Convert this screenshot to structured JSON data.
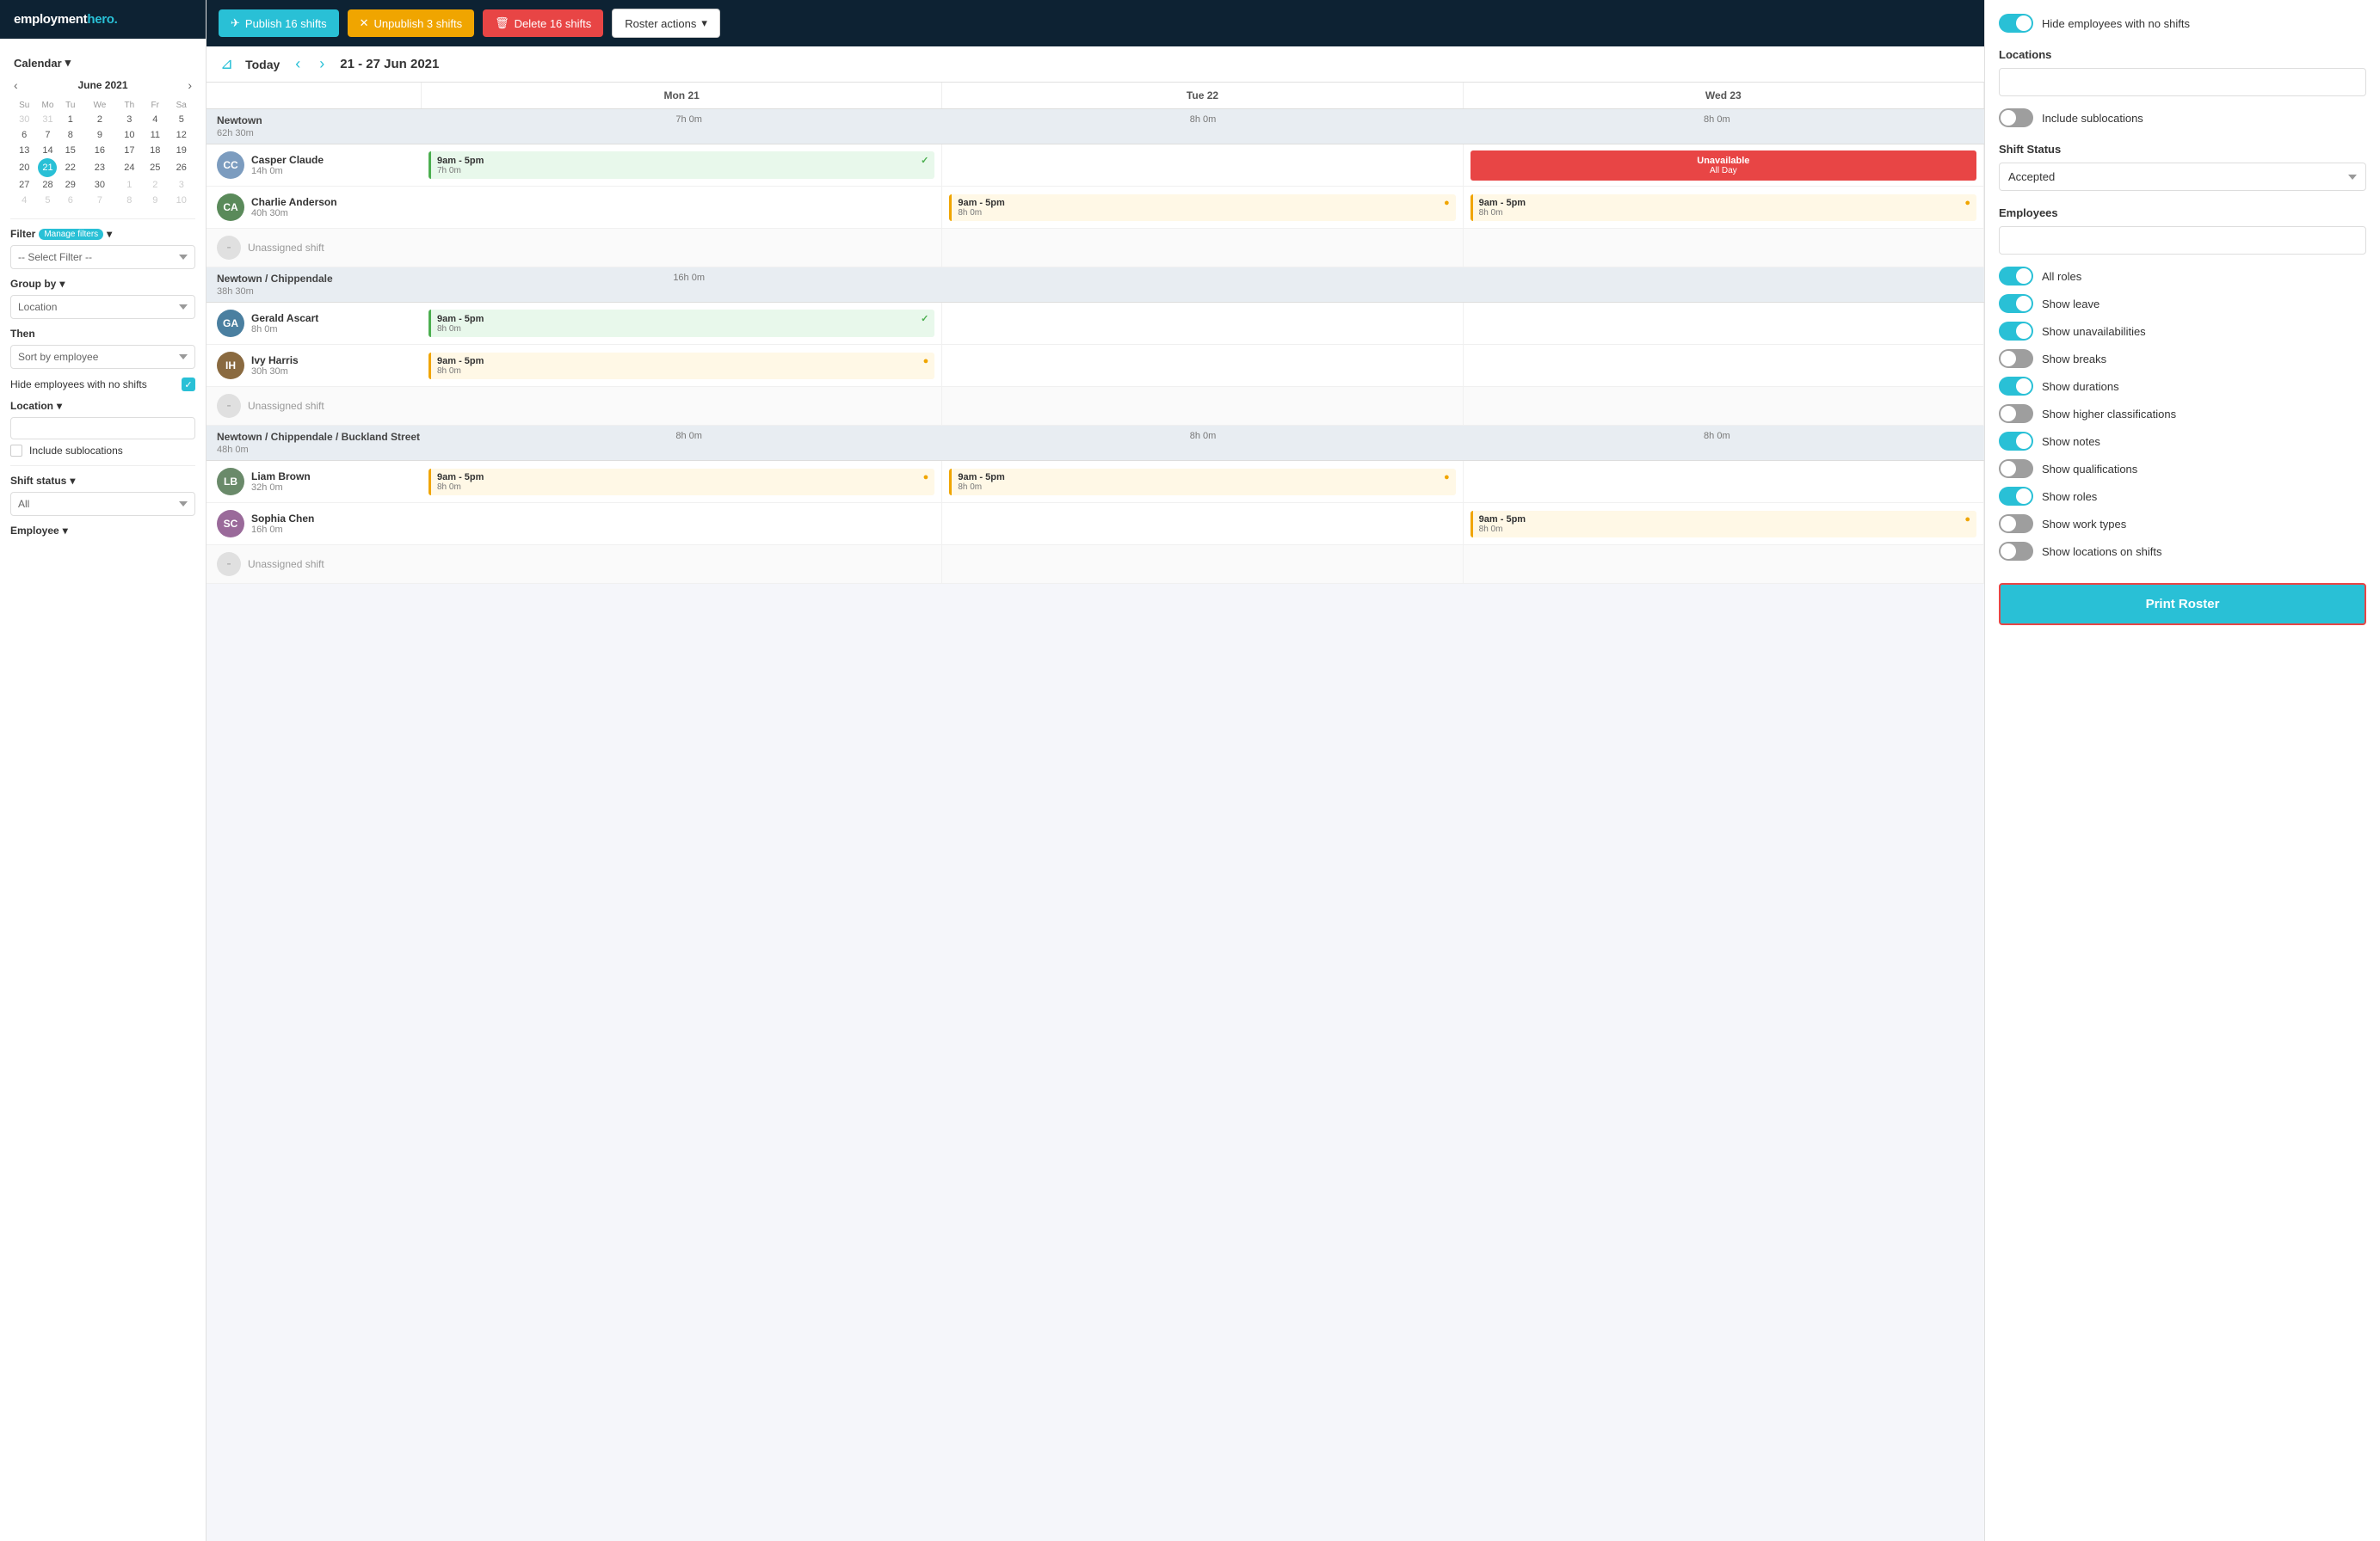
{
  "app": {
    "name": "employment",
    "name_bold": "hero.",
    "accent_color": "#29c0d6"
  },
  "topbar": {
    "publish_label": "Publish 16 shifts",
    "unpublish_label": "Unpublish 3 shifts",
    "delete_label": "Delete 16 shifts",
    "roster_actions_label": "Roster actions"
  },
  "calendar": {
    "today_label": "Today",
    "date_range": "21 - 27 Jun 2021",
    "month_label": "June 2021",
    "days": [
      "Su",
      "Mo",
      "Tu",
      "We",
      "Th",
      "Fr",
      "Sa"
    ],
    "weeks": [
      [
        30,
        31,
        1,
        2,
        3,
        4,
        5
      ],
      [
        6,
        7,
        8,
        9,
        10,
        11,
        12
      ],
      [
        13,
        14,
        15,
        16,
        17,
        18,
        19
      ],
      [
        20,
        21,
        22,
        23,
        24,
        25,
        26
      ],
      [
        27,
        28,
        29,
        30,
        1,
        2,
        3
      ],
      [
        4,
        5,
        6,
        7,
        8,
        9,
        10
      ]
    ],
    "today_date": 21,
    "col_headers": [
      "",
      "Mon 21",
      "Tue 22",
      "Wed 23"
    ]
  },
  "sidebar": {
    "filter_label": "Filter",
    "manage_filters": "Manage filters",
    "select_filter_placeholder": "-- Select Filter --",
    "group_by_label": "Group by",
    "group_by_options": [
      "Location"
    ],
    "then_label": "Then",
    "then_options": [
      "Sort by employee"
    ],
    "hide_employees_label": "Hide employees with no shifts",
    "location_label": "Location",
    "include_sublocations_label": "Include sublocations",
    "shift_status_label": "Shift status",
    "shift_status_options": [
      "All"
    ],
    "employee_label": "Employee"
  },
  "locations": [
    {
      "name": "Newtown",
      "total_hours": "62h 30m",
      "day_hours": [
        "7h 0m",
        "8h 0m",
        "8h 0m"
      ],
      "employees": [
        {
          "name": "Casper Claude",
          "hours": "14h 0m",
          "avatar_color": "#7c9cbf",
          "initials": "CC",
          "shifts": [
            {
              "day": 0,
              "time": "9am - 5pm",
              "duration": "7h 0m",
              "status": "green",
              "has_check": true
            },
            {
              "day": 1,
              "time": "",
              "duration": "",
              "status": "empty"
            },
            {
              "day": 2,
              "time": "Unavailable",
              "duration": "All Day",
              "status": "unavailable"
            }
          ]
        },
        {
          "name": "Charlie Anderson",
          "hours": "40h 30m",
          "avatar_color": "#5a8a5a",
          "initials": "CA",
          "shifts": [
            {
              "day": 0,
              "time": "",
              "duration": "",
              "status": "empty"
            },
            {
              "day": 1,
              "time": "9am - 5pm",
              "duration": "8h 0m",
              "status": "published",
              "has_check": true
            },
            {
              "day": 2,
              "time": "9am - 5pm",
              "duration": "8h 0m",
              "status": "published",
              "has_check": true
            }
          ]
        },
        {
          "name": "Unassigned shift",
          "hours": "",
          "avatar_color": "#e0e0e0",
          "initials": "-",
          "unassigned": true,
          "shifts": [
            {
              "day": 0,
              "time": "",
              "status": "empty"
            },
            {
              "day": 1,
              "time": "",
              "status": "empty"
            },
            {
              "day": 2,
              "time": "",
              "status": "empty"
            }
          ]
        }
      ]
    },
    {
      "name": "Newtown / Chippendale",
      "total_hours": "38h 30m",
      "day_hours": [
        "16h 0m",
        "",
        ""
      ],
      "employees": [
        {
          "name": "Gerald Ascart",
          "hours": "8h 0m",
          "avatar_color": "#4a7fa0",
          "initials": "GA",
          "shifts": [
            {
              "day": 0,
              "time": "9am - 5pm",
              "duration": "8h 0m",
              "status": "green",
              "has_check": true
            },
            {
              "day": 1,
              "time": "",
              "status": "empty"
            },
            {
              "day": 2,
              "time": "",
              "status": "empty"
            }
          ]
        },
        {
          "name": "Ivy Harris",
          "hours": "30h 30m",
          "avatar_color": "#8a6a40",
          "initials": "IH",
          "shifts": [
            {
              "day": 0,
              "time": "9am - 5pm",
              "duration": "8h 0m",
              "status": "published",
              "has_check": true
            },
            {
              "day": 1,
              "time": "",
              "status": "empty"
            },
            {
              "day": 2,
              "time": "",
              "status": "empty"
            }
          ]
        },
        {
          "name": "Unassigned shift",
          "hours": "",
          "avatar_color": "#e0e0e0",
          "initials": "-",
          "unassigned": true,
          "shifts": [
            {
              "day": 0,
              "time": "",
              "status": "empty"
            },
            {
              "day": 1,
              "time": "",
              "status": "empty"
            },
            {
              "day": 2,
              "time": "",
              "status": "empty"
            }
          ]
        }
      ]
    },
    {
      "name": "Newtown / Chippendale / Buckland Street",
      "total_hours": "48h 0m",
      "day_hours": [
        "8h 0m",
        "8h 0m",
        "8h 0m"
      ],
      "employees": [
        {
          "name": "Liam Brown",
          "hours": "32h 0m",
          "avatar_color": "#6a8a6a",
          "initials": "LB",
          "shifts": [
            {
              "day": 0,
              "time": "9am - 5pm",
              "duration": "8h 0m",
              "status": "published",
              "has_check": true
            },
            {
              "day": 1,
              "time": "9am - 5pm",
              "duration": "8h 0m",
              "status": "published",
              "has_check": true
            },
            {
              "day": 2,
              "time": "",
              "status": "empty"
            }
          ]
        },
        {
          "name": "Sophia Chen",
          "hours": "16h 0m",
          "avatar_color": "#9a6a9a",
          "initials": "SC",
          "shifts": [
            {
              "day": 0,
              "time": "",
              "status": "empty"
            },
            {
              "day": 1,
              "time": "",
              "status": "empty"
            },
            {
              "day": 2,
              "time": "9am - 5pm",
              "duration": "8h 0m",
              "status": "published",
              "has_check": true
            }
          ]
        },
        {
          "name": "Unassigned shift",
          "hours": "",
          "avatar_color": "#e0e0e0",
          "initials": "-",
          "unassigned": true,
          "shifts": [
            {
              "day": 0,
              "time": "",
              "status": "empty"
            },
            {
              "day": 1,
              "time": "",
              "status": "empty"
            },
            {
              "day": 2,
              "time": "",
              "status": "empty"
            }
          ]
        }
      ]
    }
  ],
  "right_panel": {
    "hide_no_shifts_label": "Hide employees with no shifts",
    "locations_label": "Locations",
    "locations_placeholder": "",
    "include_sublocations_label": "Include sublocations",
    "shift_status_label": "Shift Status",
    "shift_status_options": [
      "Accepted"
    ],
    "employees_label": "Employees",
    "employees_placeholder": "",
    "toggles": [
      {
        "label": "All roles",
        "on": true
      },
      {
        "label": "Show leave",
        "on": true
      },
      {
        "label": "Show unavailabilities",
        "on": true
      },
      {
        "label": "Show breaks",
        "on": false
      },
      {
        "label": "Show durations",
        "on": true
      },
      {
        "label": "Show higher classifications",
        "on": false
      },
      {
        "label": "Show notes",
        "on": true
      },
      {
        "label": "Show qualifications",
        "on": false
      },
      {
        "label": "Show roles",
        "on": true
      },
      {
        "label": "Show work types",
        "on": false
      },
      {
        "label": "Show locations on shifts",
        "on": false
      }
    ],
    "print_roster_label": "Print Roster"
  }
}
